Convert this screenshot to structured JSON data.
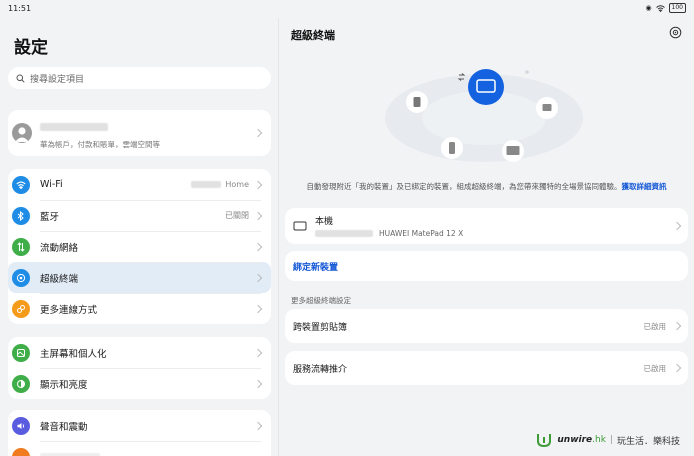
{
  "status": {
    "time": "11:51",
    "battery": "100"
  },
  "left": {
    "title": "設定",
    "search_placeholder": "搜尋設定項目",
    "account": {
      "subtitle": "華為帳戶，付款和賬單，雲端空間等"
    },
    "group1": [
      {
        "label": "Wi-Fi",
        "value": "Home",
        "color": "#1f8ce6"
      },
      {
        "label": "藍牙",
        "value": "已關閉",
        "color": "#1f8ce6"
      },
      {
        "label": "流動網絡",
        "value": "",
        "color": "#3fae49"
      },
      {
        "label": "超級終端",
        "value": "",
        "color": "#1f8ce6"
      },
      {
        "label": "更多連線方式",
        "value": "",
        "color": "#f59b1b"
      }
    ],
    "group2": [
      {
        "label": "主屏幕和個人化",
        "color": "#3fae49"
      },
      {
        "label": "顯示和亮度",
        "color": "#3fae49"
      }
    ],
    "group3": [
      {
        "label": "聲音和震動",
        "color": "#5a5ce0"
      }
    ]
  },
  "right": {
    "title": "超級終端",
    "description": "自動發現附近「我的裝置」及已綁定的裝置，組成超級終端，為您帶來獨特的全場景協同體驗。",
    "description_link": "獲取詳細資訊",
    "local_device": {
      "label": "本機",
      "model": "HUAWEI MatePad 12 X"
    },
    "bind_label": "綁定新裝置",
    "section_label": "更多超級終端設定",
    "settings": [
      {
        "label": "跨裝置剪貼簿",
        "value": "已啟用"
      },
      {
        "label": "服務流轉推介",
        "value": "已啟用"
      }
    ]
  },
  "watermark": {
    "brand": "unwire",
    "suffix": ".hk",
    "tagline": "玩生活．樂科技"
  },
  "colors": {
    "accent": "#1458d6",
    "active_row": "#e2ecf7",
    "hub": "#1462e0"
  }
}
